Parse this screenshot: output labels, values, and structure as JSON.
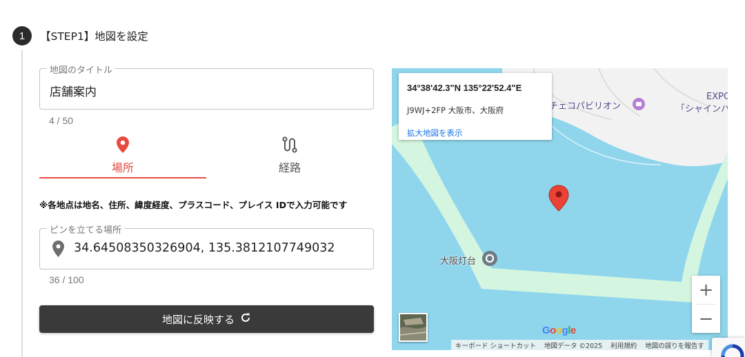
{
  "step": {
    "number": "1",
    "title": "【STEP1】地図を設定"
  },
  "title_field": {
    "legend": "地図のタイトル",
    "value": "店舗案内",
    "counter": "4 / 50"
  },
  "tabs": [
    {
      "label": "場所",
      "icon": "map-pin-icon",
      "selected": true
    },
    {
      "label": "経路",
      "icon": "route-icon",
      "selected": false
    }
  ],
  "note": "※各地点は地名、住所、緯度経度、プラスコード、プレイス IDで入力可能です",
  "pin_field": {
    "legend": "ピンを立てる場所",
    "value": "34.64508350326904, 135.3812107749032",
    "counter": "36 / 100"
  },
  "apply_button": {
    "label": "地図に反映する",
    "icon": "refresh-icon"
  },
  "map": {
    "info_card": {
      "coords": "34°38'42.3\"N 135°22'52.4\"E",
      "plus_code": "J9WJ+2FP 大阪市、大阪府",
      "link": "拡大地図を表示"
    },
    "poi_czech": "チェコパビリオン",
    "poi_expo_1": "EXPO",
    "poi_expo_2": "「シャインハ",
    "lighthouse": "大阪灯台",
    "zoom_in": "+",
    "zoom_out": "−",
    "google_logo": [
      "G",
      "o",
      "o",
      "g",
      "l",
      "e"
    ],
    "attribution": [
      "キーボード ショートカット",
      "地図データ ©2025",
      "利用規約",
      "地図の誤りを報告す"
    ],
    "colors": {
      "water": "#8fd6ec",
      "land": "#f2f2f2",
      "pier": "#d4f5e0",
      "pin": "#ea4335"
    }
  },
  "accent_color": "#e84a3f"
}
